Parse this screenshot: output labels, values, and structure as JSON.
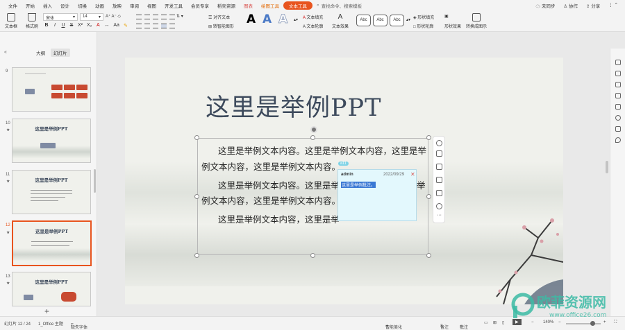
{
  "menubar": {
    "items": [
      "文件",
      "开始",
      "插入",
      "设计",
      "切换",
      "动画",
      "放映",
      "审阅",
      "视图",
      "开发工具",
      "会员专享",
      "稻壳资源"
    ],
    "context_tabs": [
      "图表",
      "绘图工具",
      "文本工具"
    ],
    "search_label": "查找命令、搜索模板",
    "unsynced": "未同步",
    "collab": "协作",
    "share": "分享"
  },
  "ribbon": {
    "textbox": "文本框",
    "format_painter": "格式刷",
    "font_name": "宋体",
    "font_size": "14",
    "align_text": "对齐文本",
    "convert_smartart": "转智能图形",
    "text_fill": "文本填充",
    "text_outline": "文本轮廓",
    "text_effect": "文本效果",
    "style_abc": [
      "Abc",
      "Abc",
      "Abc"
    ],
    "shape_fill": "形状填充",
    "shape_outline": "形状轮廓",
    "shape_effect": "形状效果",
    "convert_image": "转换成图示"
  },
  "left_panel": {
    "tabs": [
      "大纲",
      "幻灯片"
    ],
    "slide_numbers": [
      "9",
      "10",
      "11",
      "12",
      "13"
    ],
    "thumb_title": "这里是举例PPT"
  },
  "slide": {
    "title": "这里是举例PPT",
    "lines": [
      "这里是举例文本内容。这里是举例文本内容，这里是举",
      "例文本内容，这里是举例文本内容。",
      "这里是举例文本内容。这里是举",
      "举",
      "例文本内容，这里是举例文本内容。",
      "这里是举例文本内容，这里是举"
    ]
  },
  "comment": {
    "marker": "a11",
    "author": "admin",
    "date": "2022/09/29",
    "text": "这里是举例批注。"
  },
  "status": {
    "slide_info": "幻灯片 12 / 24",
    "theme": "1_Office 主题",
    "missing_font": "缺失字体",
    "smart_beautify": "智能美化",
    "notes": "备注",
    "comments": "批注",
    "zoom": "140%"
  },
  "watermark": {
    "text": "欧菲资源网",
    "url": "www.office26.com"
  },
  "colors": {
    "accent": "#e8541e",
    "title": "#3d4a5c",
    "comment_bg": "#e3f8fd"
  }
}
